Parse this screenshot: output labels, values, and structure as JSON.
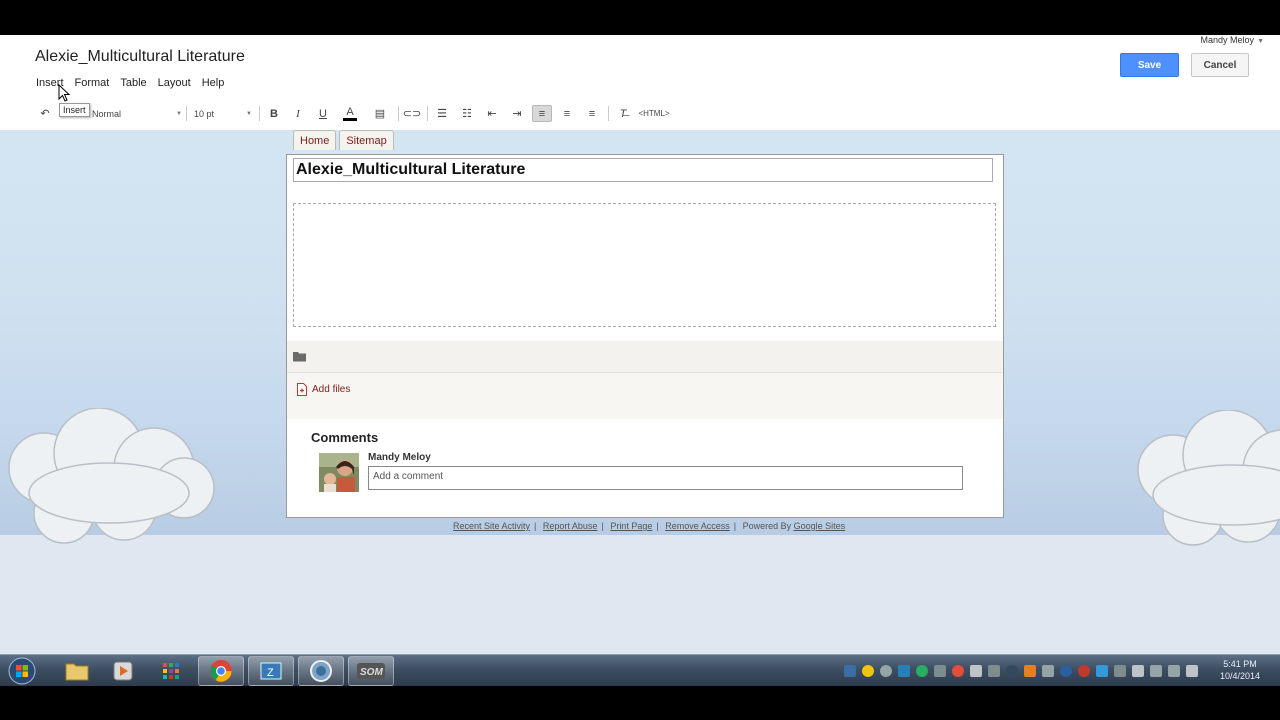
{
  "editor": {
    "doc_title": "Alexie_Multicultural Literature",
    "user_name": "Mandy Meloy",
    "save_label": "Save",
    "cancel_label": "Cancel",
    "tooltip": "Insert"
  },
  "menubar": {
    "items": [
      "Insert",
      "Format",
      "Table",
      "Layout",
      "Help"
    ]
  },
  "toolbar": {
    "style_value": "Normal",
    "font_size_value": "10 pt",
    "html_label": "<HTML>"
  },
  "site_nav": {
    "tabs": [
      "Home",
      "Sitemap"
    ]
  },
  "page": {
    "title": "Alexie_Multicultural Literature",
    "add_files_label": "Add files",
    "comments_heading": "Comments",
    "commenter": "Mandy Meloy",
    "comment_placeholder": "Add a comment"
  },
  "footer": {
    "links": [
      "Recent Site Activity",
      "Report Abuse",
      "Print Page",
      "Remove Access"
    ],
    "powered_by": "Powered By",
    "google_sites": "Google Sites"
  },
  "taskbar": {
    "clock_time": "5:41 PM",
    "clock_date": "10/4/2014"
  },
  "colors": {
    "save_blue": "#4d90fe",
    "link_red": "#7a1c1c",
    "sky_blue": "#cfe1f0"
  }
}
